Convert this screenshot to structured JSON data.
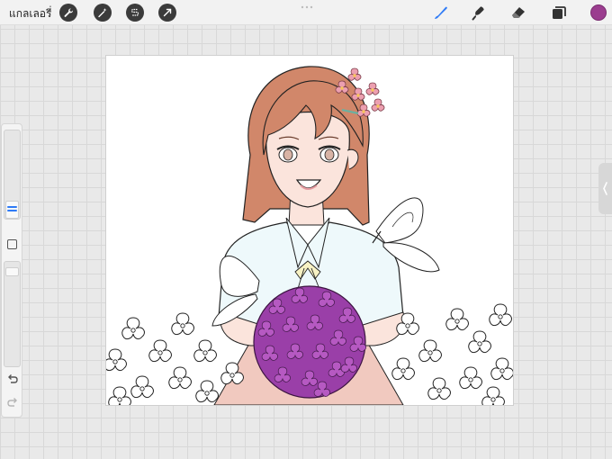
{
  "toolbar": {
    "gallery_label": "แกลเลอรี่",
    "left_tools": [
      "wrench-icon",
      "magic-wand-icon",
      "selection-icon",
      "transform-arrow-icon"
    ],
    "right_tools": [
      "brush-icon",
      "smudge-icon",
      "eraser-icon",
      "layers-icon"
    ],
    "active_tool": "brush-icon",
    "active_color": "#9b3d8f",
    "accent": "#2f7bf6"
  },
  "sidebar": {
    "tools": [
      "brush-size-slider",
      "modify-button",
      "opacity-slider",
      "undo-icon",
      "redo-icon"
    ]
  },
  "canvas": {
    "background": "#ffffff",
    "colors": {
      "hair": "#d1876a",
      "skin": "#fbe4dc",
      "shirt": "#eef9fb",
      "flower": "#a548b3",
      "hair_flower": "#e8a3ad"
    }
  }
}
